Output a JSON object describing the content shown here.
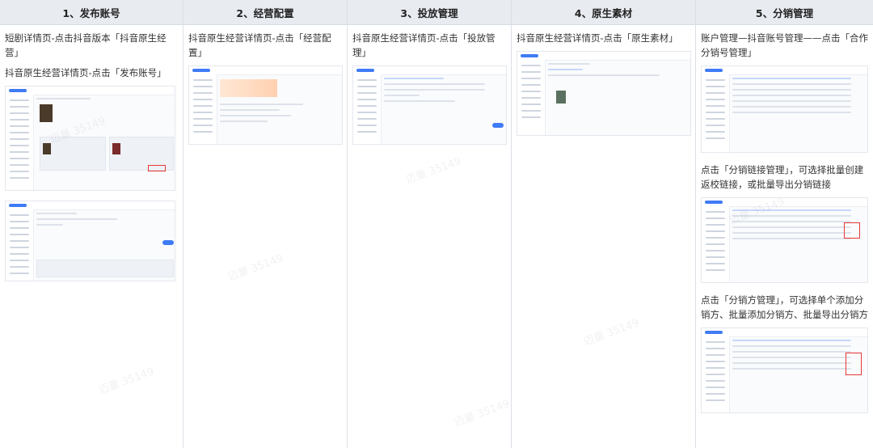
{
  "columns": [
    {
      "title": "1、发布账号",
      "paragraphs": [
        "短剧详情页-点击抖音版本「抖音原生经营」",
        "抖音原生经营详情页-点击「发布账号」"
      ]
    },
    {
      "title": "2、经营配置",
      "paragraphs": [
        "抖音原生经营详情页-点击「经营配置」"
      ]
    },
    {
      "title": "3、投放管理",
      "paragraphs": [
        "抖音原生经营详情页-点击「投放管理」"
      ]
    },
    {
      "title": "4、原生素材",
      "paragraphs": [
        "抖音原生经营详情页-点击「原生素材」"
      ]
    },
    {
      "title": "5、分销管理",
      "paragraphs": [
        "账户管理—抖音账号管理——点击「合作分销号管理」",
        "点击「分销链接管理」，可选择批量创建返校链接，或批量导出分销链接",
        "点击「分销方管理」，可选择单个添加分销方、批量添加分销方、批量导出分销方"
      ]
    }
  ],
  "watermark": "迈量 35149"
}
